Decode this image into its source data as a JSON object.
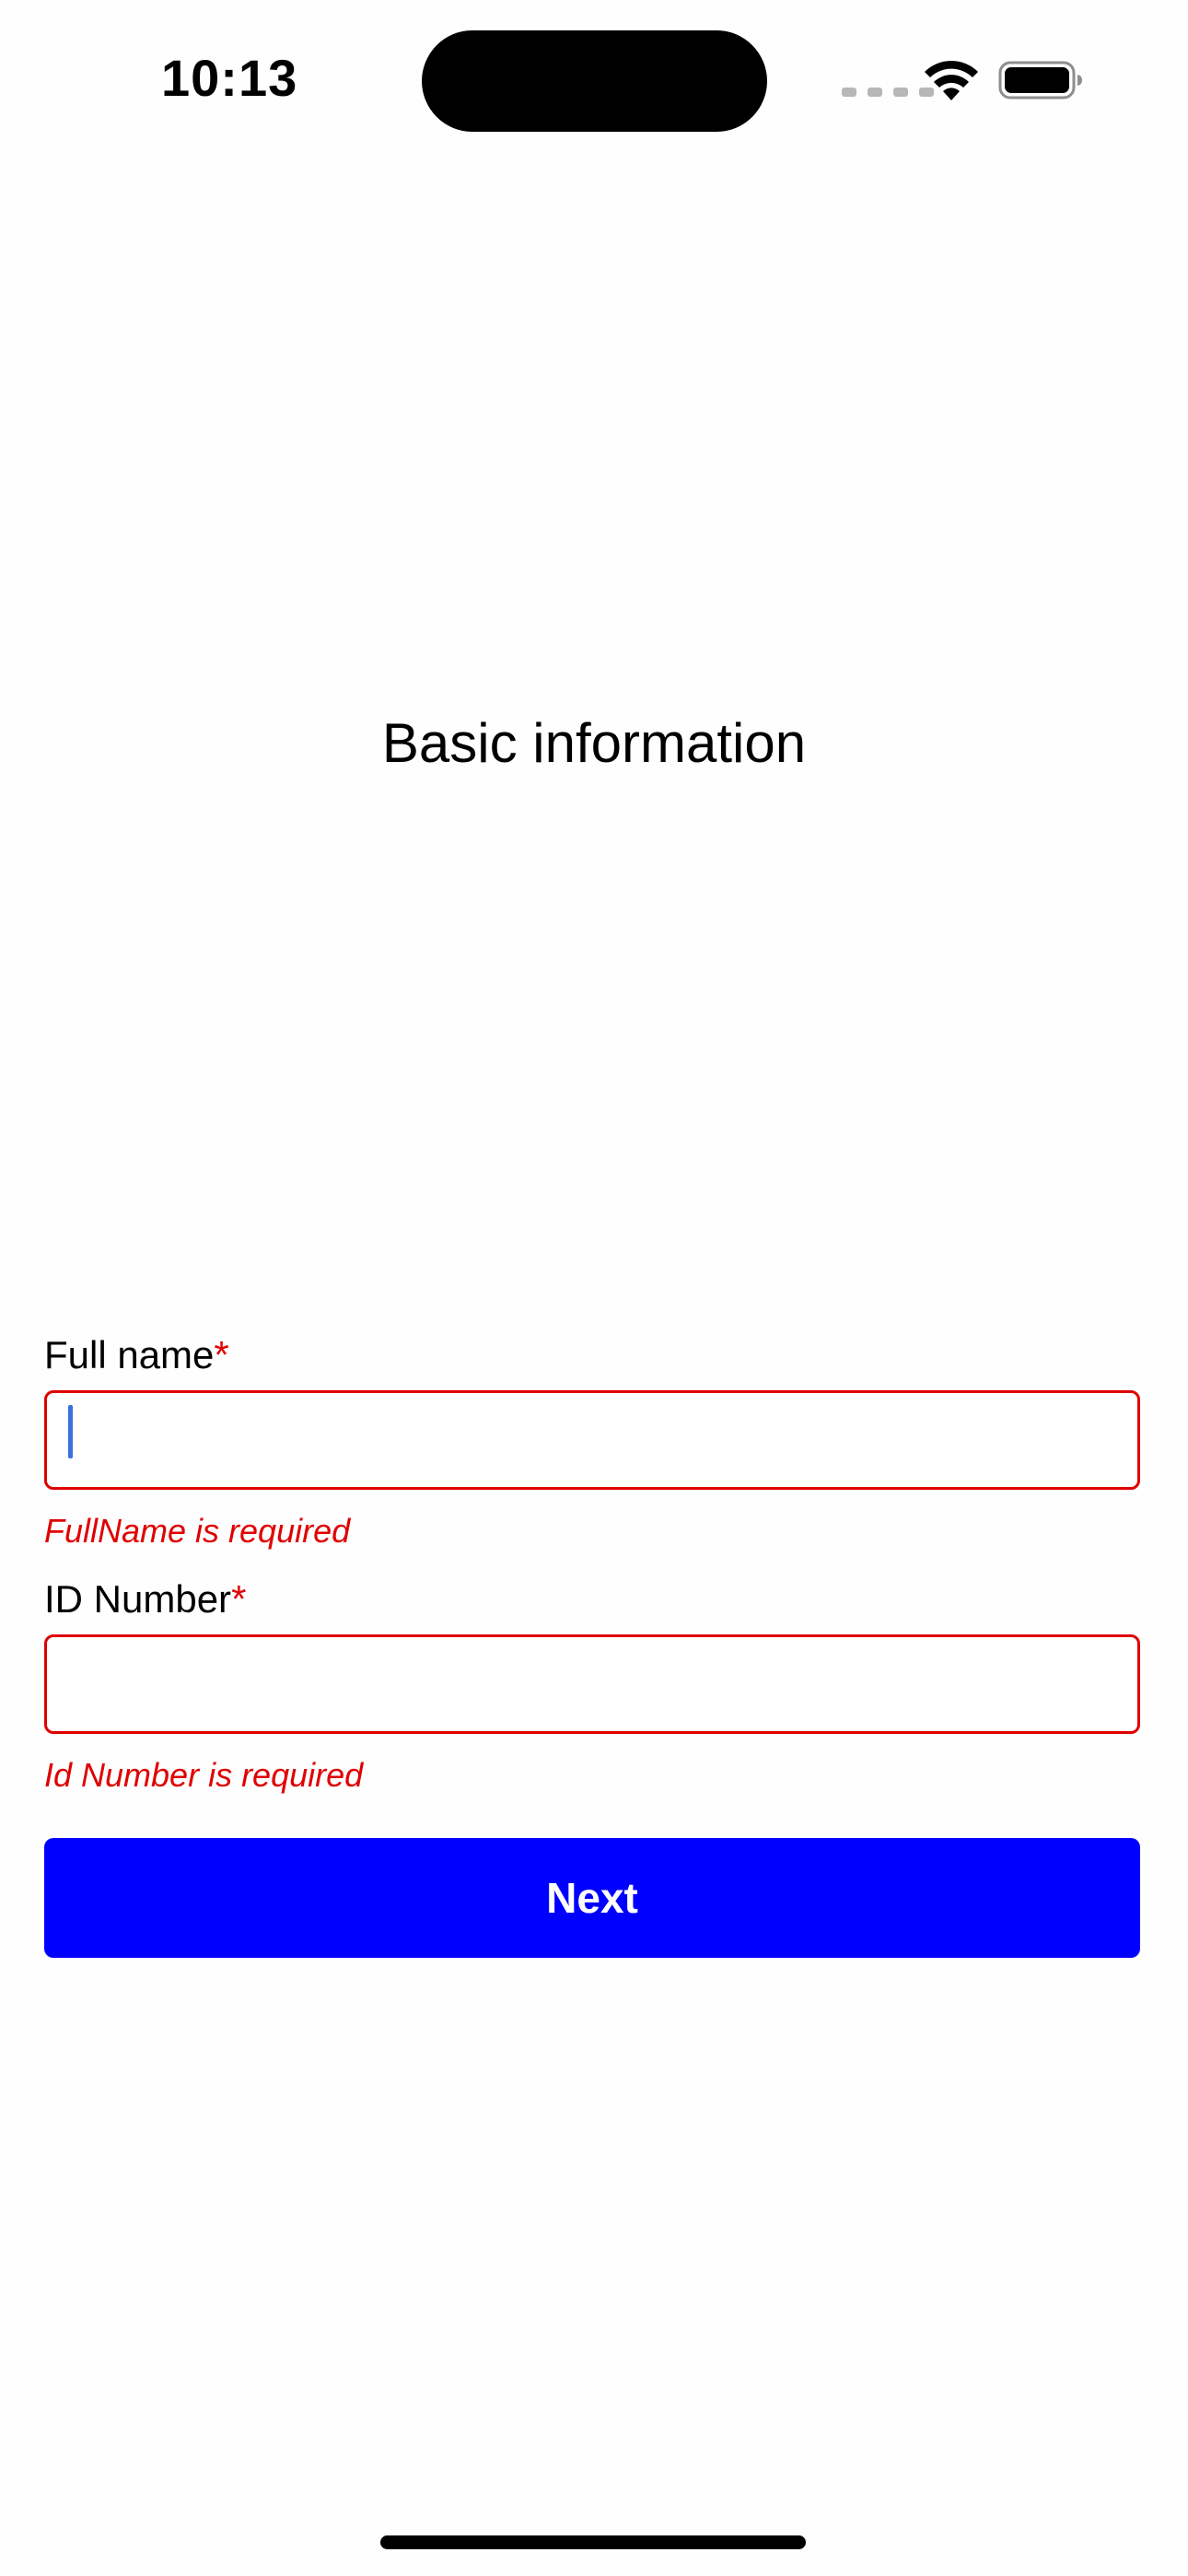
{
  "status_bar": {
    "time": "10:13"
  },
  "header": {
    "title": "Basic information"
  },
  "form": {
    "required_marker": "*",
    "full_name": {
      "label": "Full name",
      "value": "",
      "error": "FullName is required"
    },
    "id_number": {
      "label": "ID Number",
      "value": "",
      "error": "Id Number is required"
    },
    "next_label": "Next"
  },
  "colors": {
    "error": "#e00000",
    "primary_button": "#0000ff",
    "caret": "#3a6fe0"
  },
  "icons": {
    "wifi": "wifi-icon",
    "battery": "battery-icon",
    "signal": "cellular-signal-icon"
  }
}
